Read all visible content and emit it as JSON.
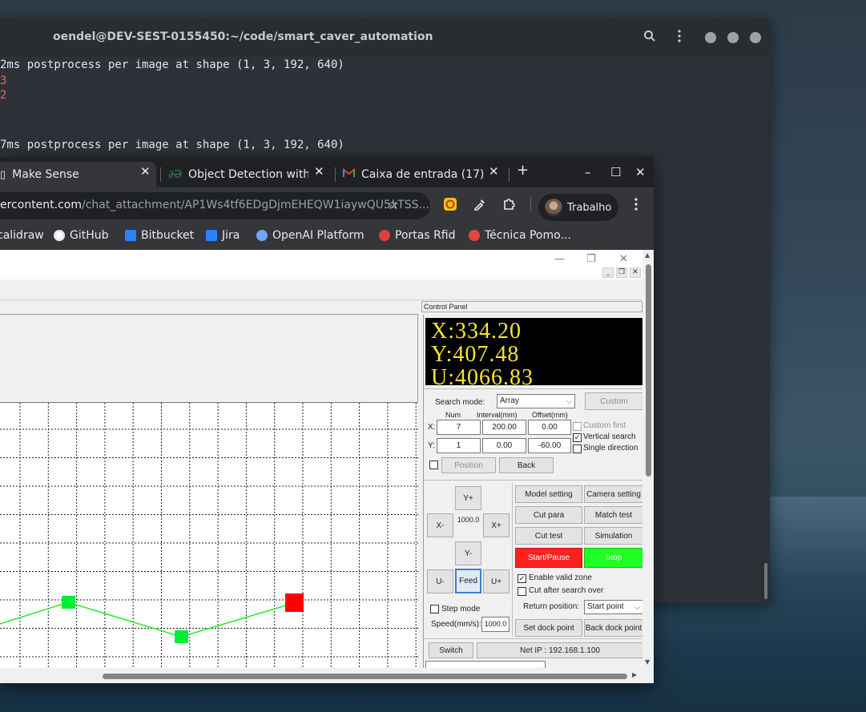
{
  "terminal": {
    "title": "oendel@DEV-SEST-0155450:~/code/smart_caver_automation",
    "lines": [
      "2ms postprocess per image at shape (1, 3, 192, 640)",
      "7ms postprocess per image at shape (1, 3, 192, 640)"
    ],
    "red_marks": [
      "3",
      "2"
    ]
  },
  "browser": {
    "tabs": [
      {
        "label": "Make Sense",
        "active": true
      },
      {
        "label": "Object Detection with",
        "active": false
      },
      {
        "label": "Caixa de entrada (17)",
        "active": false
      }
    ],
    "new_tab": "+",
    "url_host": "ercontent.com",
    "url_path": "/chat_attachment/AP1Ws4tf6EDgDjmEHEQW1iaywQU5xTSS...",
    "profile_label": "Trabalho",
    "bookmarks": [
      {
        "label": "calidraw",
        "color": "#000000"
      },
      {
        "label": "GitHub",
        "color": "#ffffff"
      },
      {
        "label": "Bitbucket",
        "color": "#2684ff"
      },
      {
        "label": "Jira",
        "color": "#2684ff"
      },
      {
        "label": "OpenAI Platform",
        "color": "#6ea8fe"
      },
      {
        "label": "Portas Rfid",
        "color": "#e04040"
      },
      {
        "label": "Técnica Pomo...",
        "color": "#e04a3c"
      }
    ]
  },
  "app": {
    "control_panel_title": "Control Panel",
    "coords": {
      "x": "X:334.20",
      "y": "Y:407.48",
      "u": "U:4066.83"
    },
    "search_mode_label": "Search mode:",
    "search_mode_value": "Array",
    "custom_button": "Custom",
    "col_num": "Num",
    "col_interval": "Interval(mm)",
    "col_offset": "Offset(mm)",
    "row_x_label": "X:",
    "row_y_label": "Y:",
    "x_num": "7",
    "x_interval": "200.00",
    "x_offset": "0.00",
    "y_num": "1",
    "y_interval": "0.00",
    "y_offset": "-60.00",
    "custom_first": "Custom first",
    "vertical_search": "Vertical search",
    "single_direction": "Single direction",
    "position_button": "Position",
    "back_button": "Back",
    "jog": {
      "y_plus": "Y+",
      "y_minus": "Y-",
      "x_minus": "X-",
      "x_plus": "X+",
      "step": "1000.0",
      "u_minus": "U-",
      "u_plus": "U+",
      "feed": "Feed"
    },
    "step_mode": "Step mode",
    "speed_label": "Speed(mm/s):",
    "speed_value": "1000.0",
    "buttons": {
      "model_setting": "Model setting",
      "camera_setting": "Camera setting",
      "cut_para": "Cut para",
      "match_test": "Match test",
      "cut_test": "Cut test",
      "simulation": "Simulation",
      "start_pause": "Start/Pause",
      "stop": "Stop",
      "set_dock": "Set dock point",
      "back_dock": "Back dock point",
      "switch": "Switch"
    },
    "enable_valid_zone": "Enable valid zone",
    "cut_after_search": "Cut after search over",
    "return_position_label": "Return position:",
    "return_position_value": "Start point",
    "net_ip": "Net IP : 192.168.1.100",
    "colors": {
      "start": "#ff2020",
      "stop": "#22ff22",
      "path": "#22ee22",
      "active_marker": "#ff0000",
      "marker": "#00ee33"
    }
  }
}
